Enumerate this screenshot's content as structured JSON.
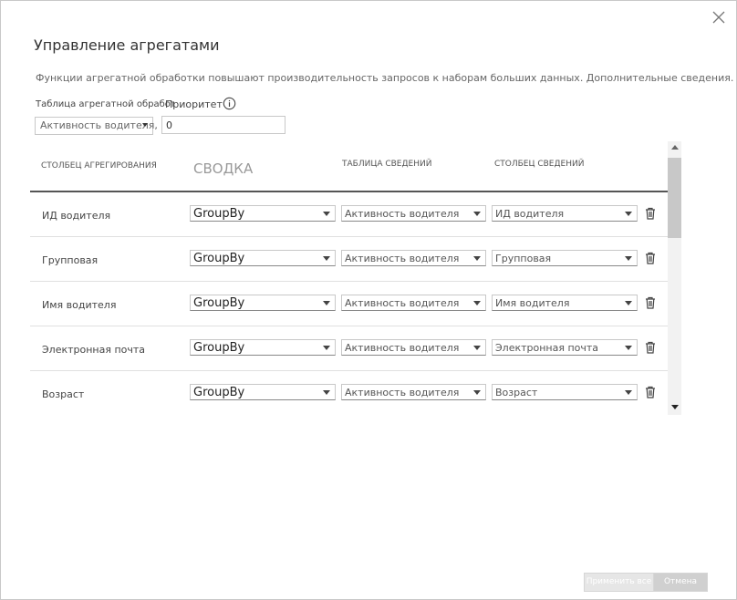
{
  "dialog": {
    "title": "Управление агрегатами",
    "description": "Функции агрегатной обработки повышают производительность запросов к наборам больших данных. Дополнительные сведения.",
    "close_icon": "close-icon"
  },
  "settings": {
    "agg_table_label": "Таблица агрегатной обработки",
    "agg_table_value": "Активность водителя, агрегат",
    "priority_label": "Приоритет",
    "priority_value": "0",
    "info_icon": "info-icon"
  },
  "grid": {
    "headers": {
      "agg_column": "СТОЛБЕЦ АГРЕГИРОВАНИЯ",
      "summarization": "СВОДКА",
      "detail_table": "ТАБЛИЦА СВЕДЕНИЙ",
      "detail_column": "СТОЛБЕЦ СВЕДЕНИЙ"
    },
    "rows": [
      {
        "label": "ИД водителя",
        "summarization": "GroupBy",
        "detail_table": "Активность водителя",
        "detail_column": "ИД водителя"
      },
      {
        "label": "Групповая",
        "summarization": "GroupBy",
        "detail_table": "Активность водителя",
        "detail_column": "Групповая"
      },
      {
        "label": "Имя водителя",
        "summarization": "GroupBy",
        "detail_table": "Активность водителя",
        "detail_column": "Имя водителя"
      },
      {
        "label": "Электронная почта",
        "summarization": "GroupBy",
        "detail_table": "Активность водителя",
        "detail_column": "Электронная почта"
      },
      {
        "label": "Возраст",
        "summarization": "GroupBy",
        "detail_table": "Активность водителя",
        "detail_column": "Возраст"
      }
    ],
    "row_icon": "trash-icon"
  },
  "footer": {
    "apply_label": "Применить все",
    "cancel_label": "Отмена"
  },
  "colors": {
    "border": "#c8c8c8",
    "header_line": "#555555",
    "disabled_button": "#e6e6e6"
  }
}
